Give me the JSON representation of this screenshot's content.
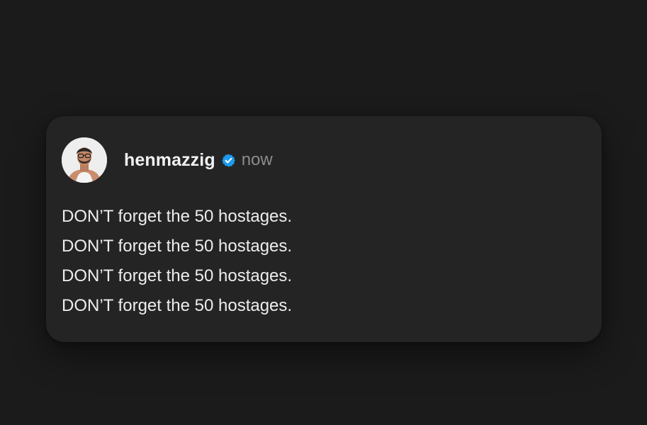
{
  "post": {
    "username": "henmazzig",
    "verified_icon": "verified-badge-icon",
    "timestamp": "now",
    "lines": [
      "DON’T forget the 50 hostages.",
      "DON’T forget the 50 hostages.",
      "DON’T forget the 50 hostages.",
      "DON’T forget the 50 hostages."
    ]
  },
  "colors": {
    "background": "#1b1b1b",
    "card": "#242424",
    "verified": "#1d9bf0",
    "text": "#ededed",
    "muted": "#8c8c8c"
  }
}
